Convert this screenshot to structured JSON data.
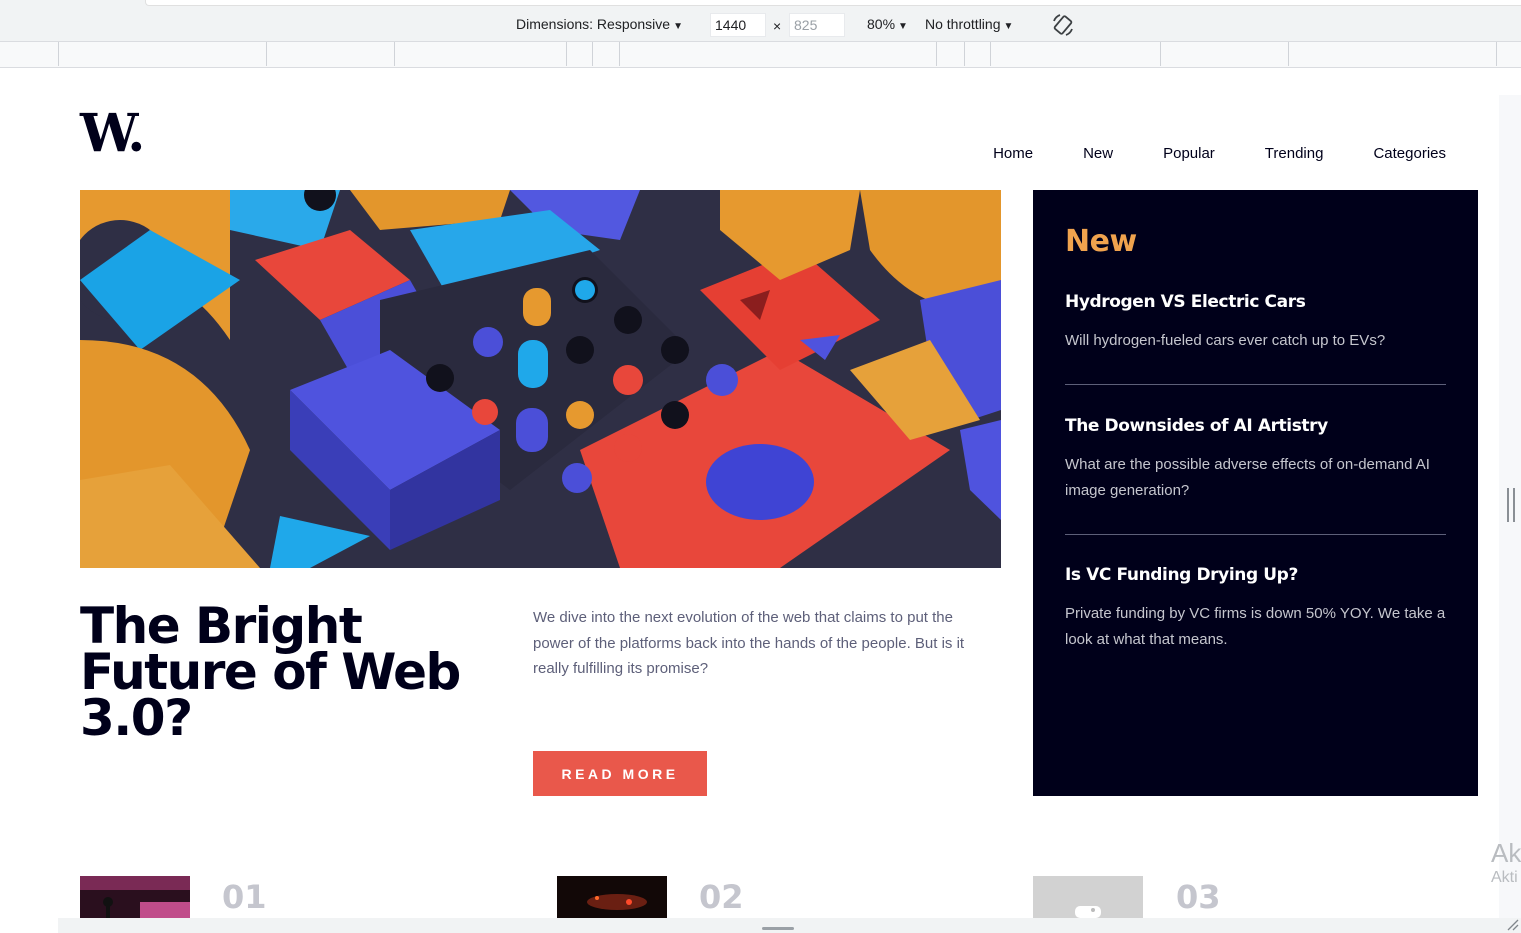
{
  "devtools": {
    "dimensions_label": "Dimensions: Responsive",
    "width_value": "1440",
    "times": "×",
    "height_placeholder": "825",
    "zoom": "80%",
    "throttling": "No throttling"
  },
  "site": {
    "logo": "W.",
    "nav": [
      "Home",
      "New",
      "Popular",
      "Trending",
      "Categories"
    ]
  },
  "hero": {
    "title": "The Bright Future of Web 3.0?",
    "description": "We dive into the next evolution of the web that claims to put the power of the platforms back into the hands of the people. But is it really fulfilling its promise?",
    "cta": "READ MORE"
  },
  "new_panel": {
    "heading": "New",
    "items": [
      {
        "title": "Hydrogen VS Electric Cars",
        "desc": "Will hydrogen-fueled cars ever catch up to EVs?"
      },
      {
        "title": "The Downsides of AI Artistry",
        "desc": "What are the possible adverse effects of on-demand AI image generation?"
      },
      {
        "title": "Is VC Funding Drying Up?",
        "desc": "Private funding by VC firms is down 50% YOY. We take a look at what that means."
      }
    ]
  },
  "bottom_cards": [
    "01",
    "02",
    "03"
  ],
  "watermark": {
    "line1": "Ak",
    "line2": "Akti"
  },
  "colors": {
    "accent_orange": "#f0a34e",
    "cta_red": "#e9584b",
    "navy": "#00001a",
    "muted_text": "#5d5f79"
  }
}
